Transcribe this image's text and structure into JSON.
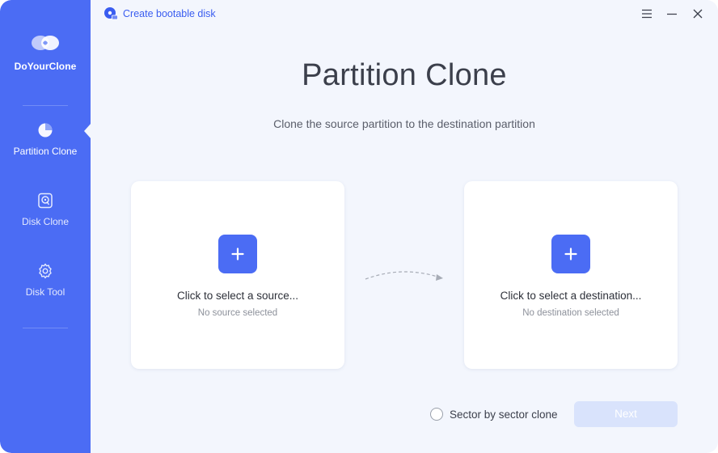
{
  "app": {
    "name": "DoYourClone"
  },
  "titlebar": {
    "bootable_label": "Create bootable disk",
    "menu_icon": "menu-icon",
    "minimize_icon": "minimize-icon",
    "close_icon": "close-icon"
  },
  "sidebar": {
    "items": [
      {
        "label": "Partition Clone",
        "icon": "pie-chart-icon",
        "active": true
      },
      {
        "label": "Disk Clone",
        "icon": "disk-icon",
        "active": false
      },
      {
        "label": "Disk Tool",
        "icon": "gear-icon",
        "active": false
      }
    ]
  },
  "main": {
    "title": "Partition Clone",
    "subtitle": "Clone the source partition to the destination partition",
    "source": {
      "title": "Click to select a source...",
      "status": "No source selected"
    },
    "destination": {
      "title": "Click to select a destination...",
      "status": "No destination selected"
    },
    "sector_option": {
      "label": "Sector by sector clone",
      "checked": false
    },
    "next_label": "Next"
  },
  "colors": {
    "accent": "#4b6cf4",
    "background": "#f3f6fd",
    "next_disabled": "#d9e3fc"
  }
}
